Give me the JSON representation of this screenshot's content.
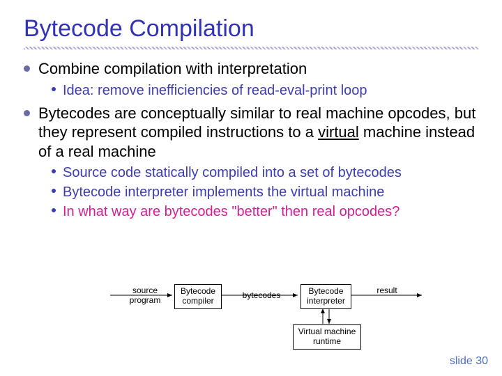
{
  "title": "Bytecode Compilation",
  "bullets": {
    "b1": "Combine compilation with interpretation",
    "b1s1": "Idea: remove inefficiencies of read-eval-print loop",
    "b2a": "Bytecodes are conceptually similar to real machine opcodes, but they represent compiled instructions to a ",
    "b2b": "virtual",
    "b2c": " machine instead of a real machine",
    "b2s1": "Source code statically compiled into a set of bytecodes",
    "b2s2": "Bytecode interpreter implements the virtual machine",
    "b2s3": "In what way are bytecodes \"better\" then real opcodes?"
  },
  "diagram": {
    "source_l1": "source",
    "source_l2": "program",
    "compiler_l1": "Bytecode",
    "compiler_l2": "compiler",
    "mid": "bytecodes",
    "interp_l1": "Bytecode",
    "interp_l2": "interpreter",
    "vm_l1": "Virtual machine",
    "vm_l2": "runtime",
    "result": "result"
  },
  "footer": "slide 30"
}
